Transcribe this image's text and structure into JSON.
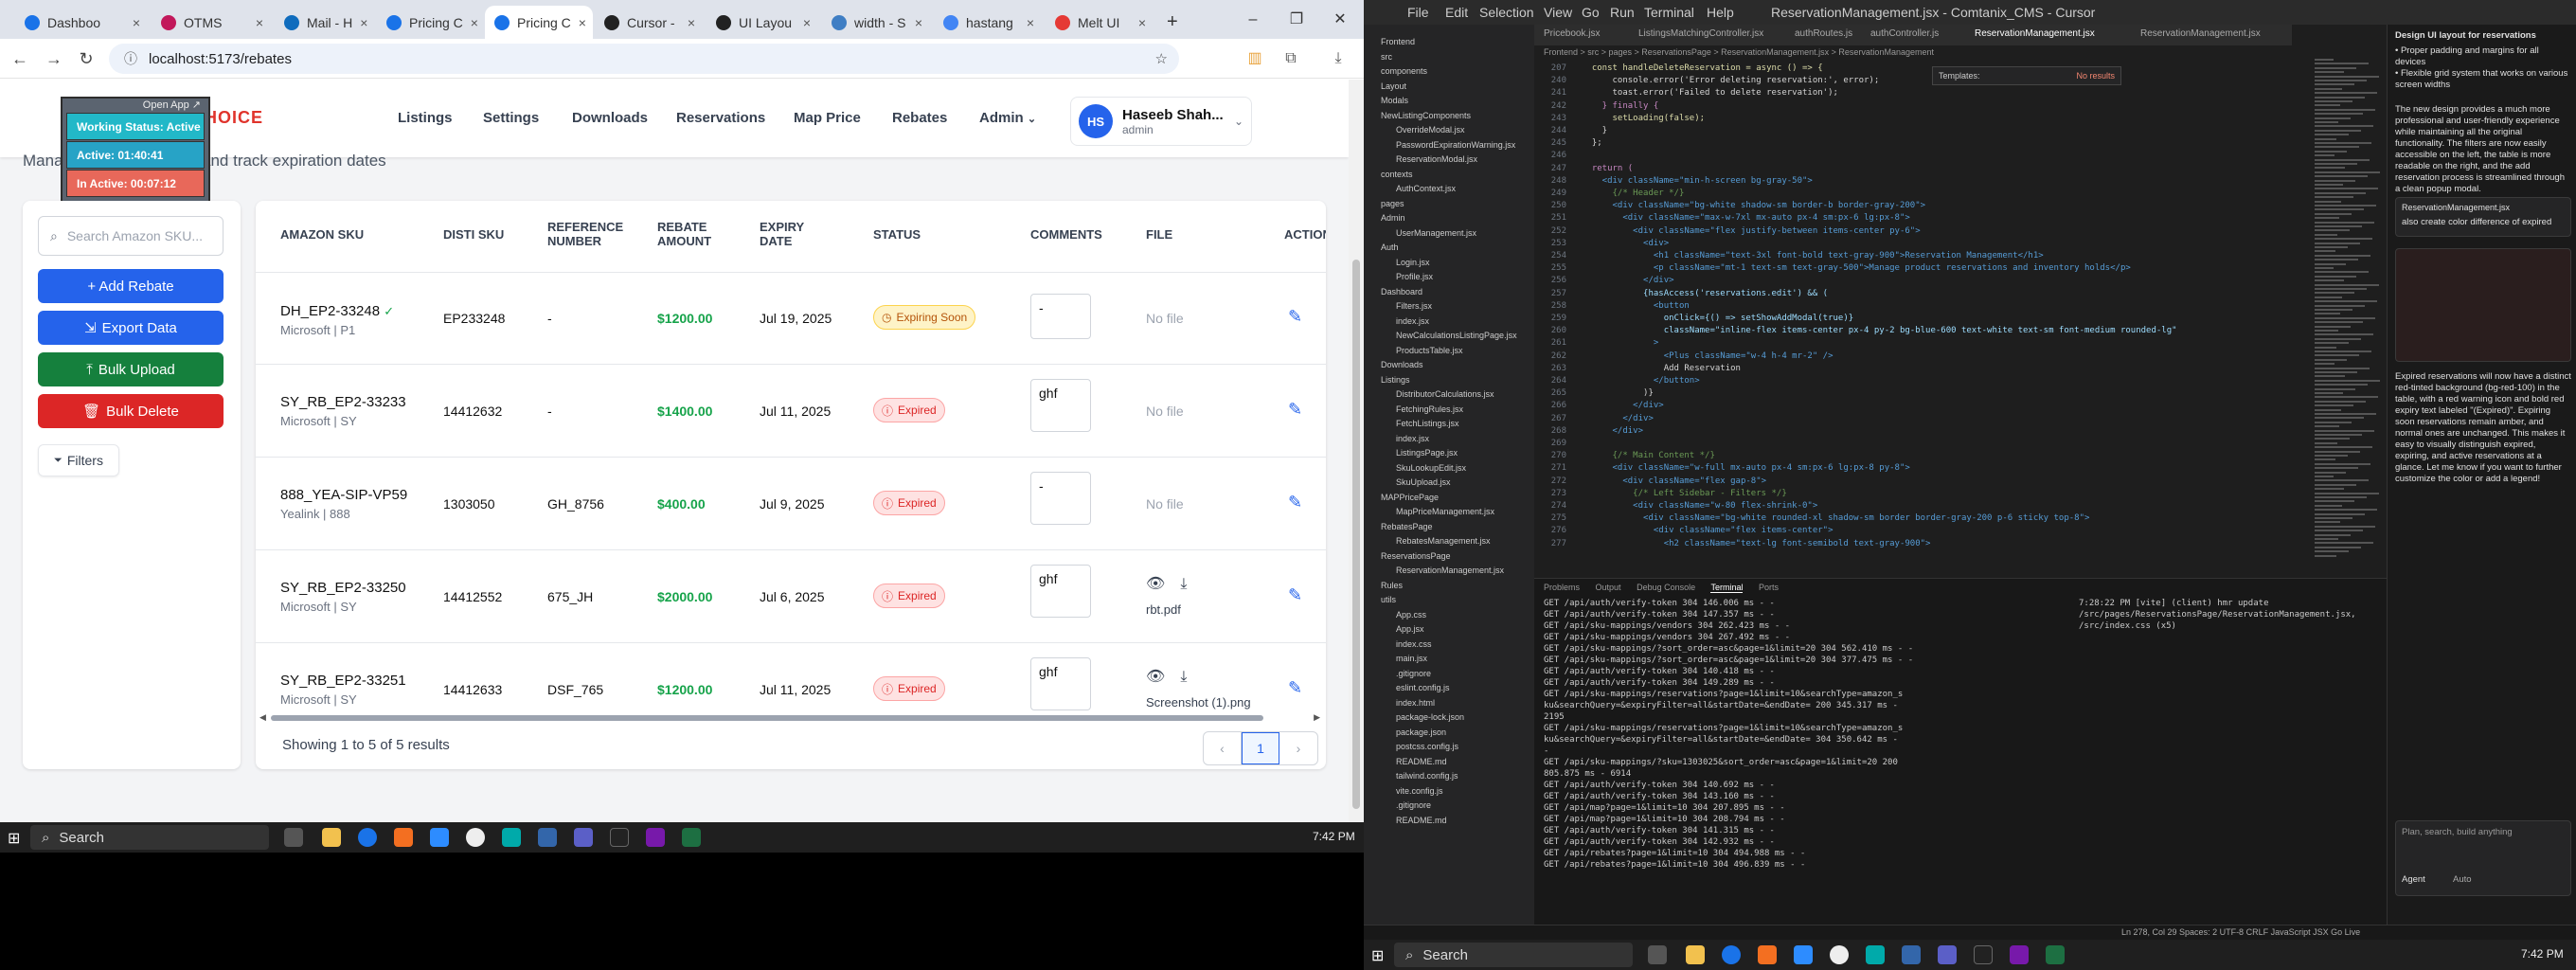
{
  "browser": {
    "tabs": [
      {
        "label": "Dashboo",
        "color": "#1a73e8"
      },
      {
        "label": "OTMS",
        "color": "#c2185b"
      },
      {
        "label": "Mail - H",
        "color": "#0f6cbd"
      },
      {
        "label": "Pricing C",
        "color": "#1a73e8"
      },
      {
        "label": "Pricing C",
        "color": "#1a73e8"
      },
      {
        "label": "Cursor -",
        "color": "#222222"
      },
      {
        "label": "UI Layou",
        "color": "#222222"
      },
      {
        "label": "width - S",
        "color": "#3f7ec4"
      },
      {
        "label": "hastang",
        "color": "#4285f4"
      },
      {
        "label": "Melt UI",
        "color": "#e53935"
      }
    ],
    "new_tab": "+",
    "url": "localhost:5173/rebates"
  },
  "app": {
    "logo": "VCLOUDCHOICE",
    "nav": [
      "Listings",
      "Settings",
      "Downloads",
      "Reservations",
      "Map Price",
      "Rebates",
      "Admin"
    ],
    "user": {
      "initials": "HS",
      "name": "Haseeb Shah...",
      "role": "admin"
    },
    "subtitle": "Manage product rebates and track expiration dates",
    "overlay": {
      "open_app": "Open App ↗",
      "working": "Working Status: Active",
      "active": "Active: 01:40:41",
      "inactive": "In Active: 00:07:12"
    },
    "search_placeholder": "Search Amazon SKU...",
    "buttons": {
      "add": "+ Add Rebate",
      "export": "Export Data",
      "upload": "Bulk Upload",
      "delete": "Bulk Delete",
      "filters": "Filters"
    },
    "columns": [
      "AMAZON SKU",
      "DISTI SKU",
      "REFERENCE NUMBER",
      "REBATE AMOUNT",
      "EXPIRY DATE",
      "STATUS",
      "COMMENTS",
      "FILE",
      "ACTION"
    ],
    "rows": [
      {
        "sku": "DH_EP2-33248",
        "vendor": "Microsoft | P1",
        "disti": "EP233248",
        "ref": "-",
        "amount": "$1200.00",
        "expiry": "Jul 19, 2025",
        "status": "Expiring Soon",
        "comment": "-",
        "file": "No file"
      },
      {
        "sku": "SY_RB_EP2-33233",
        "vendor": "Microsoft | SY",
        "disti": "14412632",
        "ref": "-",
        "amount": "$1400.00",
        "expiry": "Jul 11, 2025",
        "status": "Expired",
        "comment": "ghf",
        "file": "No file"
      },
      {
        "sku": "888_YEA-SIP-VP59",
        "vendor": "Yealink | 888",
        "disti": "1303050",
        "ref": "GH_8756",
        "amount": "$400.00",
        "expiry": "Jul 9, 2025",
        "status": "Expired",
        "comment": "-",
        "file": "No file"
      },
      {
        "sku": "SY_RB_EP2-33250",
        "vendor": "Microsoft | SY",
        "disti": "14412552",
        "ref": "675_JH",
        "amount": "$2000.00",
        "expiry": "Jul 6, 2025",
        "status": "Expired",
        "comment": "ghf",
        "file": "rbt.pdf"
      },
      {
        "sku": "SY_RB_EP2-33251",
        "vendor": "Microsoft | SY",
        "disti": "14412633",
        "ref": "DSF_765",
        "amount": "$1200.00",
        "expiry": "Jul 11, 2025",
        "status": "Expired",
        "comment": "ghf",
        "file": "Screenshot (1).png"
      }
    ],
    "results": "Showing 1 to 5 of 5 results",
    "page": "1",
    "colors": {
      "add": "#2563eb",
      "export": "#2563eb",
      "upload": "#15803d",
      "delete": "#dc2626",
      "amount": "#16a34a",
      "expiring": "#d97706",
      "expired": "#dc2626"
    }
  },
  "taskbar": {
    "search": "Search",
    "time": "7:42 PM"
  },
  "cursor": {
    "menu": [
      "File",
      "Edit",
      "Selection",
      "View",
      "Go",
      "Run",
      "Terminal",
      "Help"
    ],
    "title": "ReservationManagement.jsx - Comtanix_CMS - Cursor",
    "tabs": [
      "Pricebook.jsx",
      "ListingsMatchingController.jsx",
      "authRoutes.js",
      "authController.js",
      "ReservationManagement.jsx",
      "ReservationManagement.jsx"
    ],
    "breadcrumb": "Frontend > src > pages > ReservationsPage > ReservationManagement.jsx > ReservationManagement",
    "find_label": "Templates:",
    "find_result": "No results",
    "files": [
      "Frontend",
      "src",
      "components",
      "Layout",
      "Modals",
      "NewListingComponents",
      "OverrideModal.jsx",
      "PasswordExpirationWarning.jsx",
      "ReservationModal.jsx",
      "contexts",
      "AuthContext.jsx",
      "pages",
      "Admin",
      "UserManagement.jsx",
      "Auth",
      "Login.jsx",
      "Profile.jsx",
      "Dashboard",
      "Filters.jsx",
      "index.jsx",
      "NewCalculationsListingPage.jsx",
      "ProductsTable.jsx",
      "Downloads",
      "Listings",
      "DistributorCalculations.jsx",
      "FetchingRules.jsx",
      "FetchListings.jsx",
      "index.jsx",
      "ListingsPage.jsx",
      "SkuLookupEdit.jsx",
      "SkuUpload.jsx",
      "MAPPricePage",
      "MapPriceManagement.jsx",
      "RebatesPage",
      "RebatesManagement.jsx",
      "ReservationsPage",
      "ReservationManagement.jsx",
      "Rules",
      "utils",
      "App.css",
      "App.jsx",
      "index.css",
      "main.jsx",
      ".gitignore",
      "eslint.config.js",
      "index.html",
      "package-lock.json",
      "package.json",
      "postcss.config.js",
      "README.md",
      "tailwind.config.js",
      "vite.config.js",
      ".gitignore",
      "README.md"
    ],
    "code": [
      {
        "n": "207",
        "t": "  const handleDeleteReservation = async () => {",
        "c": "fn"
      },
      {
        "n": "240",
        "t": "      console.error('Error deleting reservation:', error);",
        "c": "tx"
      },
      {
        "n": "241",
        "t": "      toast.error('Failed to delete reservation');",
        "c": "tx"
      },
      {
        "n": "242",
        "t": "    } finally {",
        "c": "kw"
      },
      {
        "n": "243",
        "t": "      setLoading(false);",
        "c": "fn"
      },
      {
        "n": "244",
        "t": "    }",
        "c": "tx"
      },
      {
        "n": "245",
        "t": "  };",
        "c": "tx"
      },
      {
        "n": "246",
        "t": "",
        "c": "tx"
      },
      {
        "n": "247",
        "t": "  return (",
        "c": "kw"
      },
      {
        "n": "248",
        "t": "    <div className=\"min-h-screen bg-gray-50\">",
        "c": "tg"
      },
      {
        "n": "249",
        "t": "      {/* Header */}",
        "c": "cm"
      },
      {
        "n": "250",
        "t": "      <div className=\"bg-white shadow-sm border-b border-gray-200\">",
        "c": "tg"
      },
      {
        "n": "251",
        "t": "        <div className=\"max-w-7xl mx-auto px-4 sm:px-6 lg:px-8\">",
        "c": "tg"
      },
      {
        "n": "252",
        "t": "          <div className=\"flex justify-between items-center py-6\">",
        "c": "tg"
      },
      {
        "n": "253",
        "t": "            <div>",
        "c": "tg"
      },
      {
        "n": "254",
        "t": "              <h1 className=\"text-3xl font-bold text-gray-900\">Reservation Management</h1>",
        "c": "tg"
      },
      {
        "n": "255",
        "t": "              <p className=\"mt-1 text-sm text-gray-500\">Manage product reservations and inventory holds</p>",
        "c": "tg"
      },
      {
        "n": "256",
        "t": "            </div>",
        "c": "tg"
      },
      {
        "n": "257",
        "t": "            {hasAccess('reservations.edit') && (",
        "c": "at"
      },
      {
        "n": "258",
        "t": "              <button",
        "c": "tg"
      },
      {
        "n": "259",
        "t": "                onClick={() => setShowAddModal(true)}",
        "c": "at"
      },
      {
        "n": "260",
        "t": "                className=\"inline-flex items-center px-4 py-2 bg-blue-600 text-white text-sm font-medium rounded-lg\"",
        "c": "at"
      },
      {
        "n": "261",
        "t": "              >",
        "c": "tg"
      },
      {
        "n": "262",
        "t": "                <Plus className=\"w-4 h-4 mr-2\" />",
        "c": "tg"
      },
      {
        "n": "263",
        "t": "                Add Reservation",
        "c": "tx"
      },
      {
        "n": "264",
        "t": "              </button>",
        "c": "tg"
      },
      {
        "n": "265",
        "t": "            )}",
        "c": "tx"
      },
      {
        "n": "266",
        "t": "          </div>",
        "c": "tg"
      },
      {
        "n": "267",
        "t": "        </div>",
        "c": "tg"
      },
      {
        "n": "268",
        "t": "      </div>",
        "c": "tg"
      },
      {
        "n": "269",
        "t": "",
        "c": "tx"
      },
      {
        "n": "270",
        "t": "      {/* Main Content */}",
        "c": "cm"
      },
      {
        "n": "271",
        "t": "      <div className=\"w-full mx-auto px-4 sm:px-6 lg:px-8 py-8\">",
        "c": "tg"
      },
      {
        "n": "272",
        "t": "        <div className=\"flex gap-8\">",
        "c": "tg"
      },
      {
        "n": "273",
        "t": "          {/* Left Sidebar - Filters */}",
        "c": "cm"
      },
      {
        "n": "274",
        "t": "          <div className=\"w-80 flex-shrink-0\">",
        "c": "tg"
      },
      {
        "n": "275",
        "t": "            <div className=\"bg-white rounded-xl shadow-sm border border-gray-200 p-6 sticky top-8\">",
        "c": "tg"
      },
      {
        "n": "276",
        "t": "              <div className=\"flex items-center\">",
        "c": "tg"
      },
      {
        "n": "277",
        "t": "                <h2 className=\"text-lg font-semibold text-gray-900\">",
        "c": "tg"
      }
    ],
    "panel_tabs": [
      "Problems",
      "Output",
      "Debug Console",
      "Terminal",
      "Ports"
    ],
    "terminal": [
      "GET /api/auth/verify-token 304 146.006 ms - -",
      "GET /api/auth/verify-token 304 147.357 ms - -",
      "GET /api/sku-mappings/vendors 304 262.423 ms - -",
      "GET /api/sku-mappings/vendors 304 267.492 ms - -",
      "GET /api/sku-mappings/?sort_order=asc&page=1&limit=20 304 562.410 ms - -",
      "GET /api/sku-mappings/?sort_order=asc&page=1&limit=20 304 377.475 ms - -",
      "GET /api/auth/verify-token 304 140.418 ms - -",
      "GET /api/auth/verify-token 304 149.289 ms - -",
      "GET /api/sku-mappings/reservations?page=1&limit=10&searchType=amazon_s",
      "ku&searchQuery=&expiryFilter=all&startDate=&endDate= 200 345.317 ms -",
      "2195",
      "GET /api/sku-mappings/reservations?page=1&limit=10&searchType=amazon_s",
      "ku&searchQuery=&expiryFilter=all&startDate=&endDate= 304 350.642 ms -",
      "-",
      "GET /api/sku-mappings/?sku=1303025&sort_order=asc&page=1&limit=20 200",
      "805.875 ms - 6914",
      "GET /api/auth/verify-token 304 140.692 ms - -",
      "GET /api/auth/verify-token 304 143.160 ms - -",
      "GET /api/map?page=1&limit=10 304 207.895 ms - -",
      "GET /api/map?page=1&limit=10 304 208.794 ms - -",
      "GET /api/auth/verify-token 304 141.315 ms - -",
      "GET /api/auth/verify-token 304 142.932 ms - -",
      "GET /api/rebates?page=1&limit=10 304 494.988 ms - -",
      "GET /api/rebates?page=1&limit=10 304 496.839 ms - -"
    ],
    "terminal2": "7:28:22 PM [vite] (client) hmr update /src/pages/ReservationsPage/ReservationManagement.jsx, /src/index.css (x5)",
    "chat": {
      "header": "Design UI layout for reservations",
      "bullets": [
        "Proper padding and margins for all devices",
        "Flexible grid system that works on various screen widths"
      ],
      "para": "The new design provides a much more professional and user-friendly experience while maintaining all the original functionality. The filters are now easily accessible on the left, the table is more readable on the right, and the add reservation process is streamlined through a clean popup modal.",
      "file": "ReservationManagement.jsx",
      "ask": "also create color difference of expired",
      "para2": "Expired reservations will now have a distinct red-tinted background (bg-red-100) in the table, with a red warning icon and bold red expiry text labeled \"(Expired)\". Expiring soon reservations remain amber, and normal ones are unchanged. This makes it easy to visually distinguish expired, expiring, and active reservations at a glance. Let me know if you want to further customize the color or add a legend!",
      "input": "Plan, search, build anything",
      "agent": "Agent",
      "auto": "Auto"
    },
    "status": "Ln 278, Col 29  Spaces: 2  UTF-8  CRLF  JavaScript JSX  Go Live"
  }
}
